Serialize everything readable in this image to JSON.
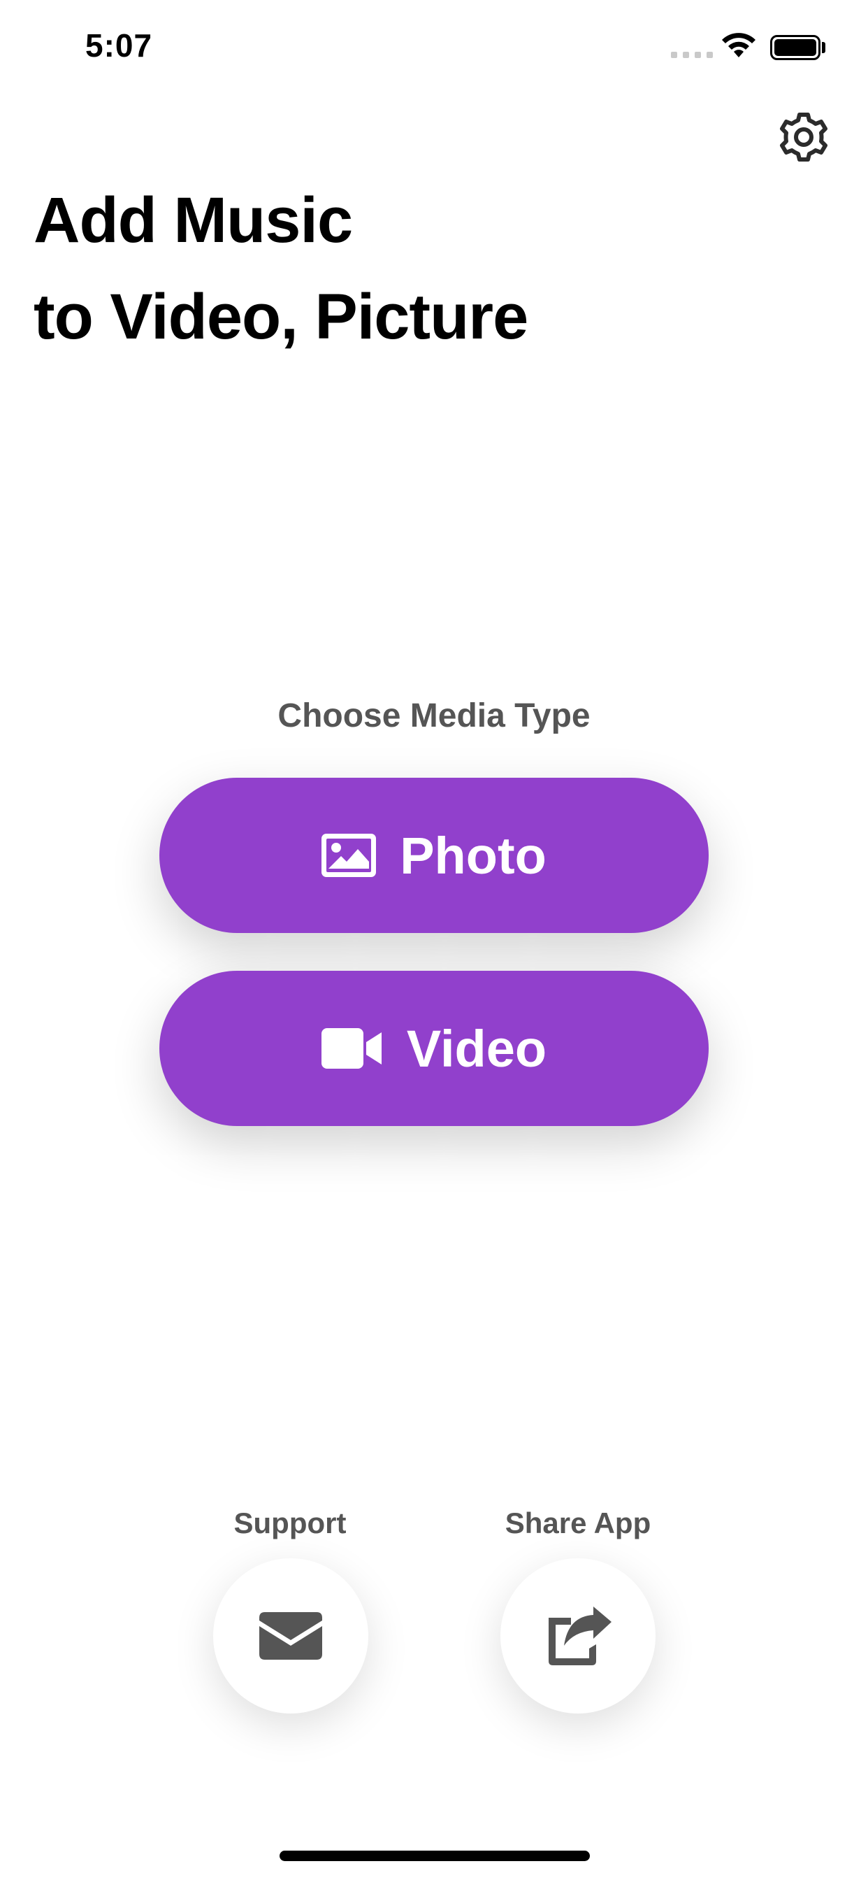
{
  "status_bar": {
    "time": "5:07"
  },
  "header": {
    "settings_icon": "gear-icon",
    "title_line1": "Add Music",
    "title_line2": "to Video, Picture"
  },
  "media": {
    "label": "Choose Media Type",
    "photo_label": "Photo",
    "photo_icon": "image-icon",
    "video_label": "Video",
    "video_icon": "video-camera-icon",
    "button_color": "#9140cc"
  },
  "actions": {
    "support_label": "Support",
    "support_icon": "envelope-icon",
    "share_label": "Share App",
    "share_icon": "share-icon",
    "icon_color": "#555555"
  }
}
